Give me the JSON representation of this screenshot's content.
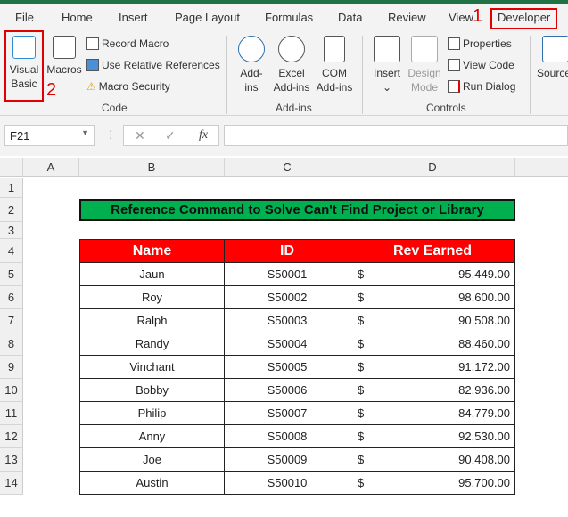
{
  "tabs": [
    "File",
    "Home",
    "Insert",
    "Page Layout",
    "Formulas",
    "Data",
    "Review",
    "View",
    "Developer"
  ],
  "annotations": {
    "one": "1",
    "two": "2"
  },
  "ribbon": {
    "code": {
      "visual_basic": [
        "Visual",
        "Basic"
      ],
      "macros": "Macros",
      "record_macro": "Record Macro",
      "relative": "Use Relative References",
      "security": "Macro Security",
      "label": "Code"
    },
    "addins": {
      "addins": [
        "Add-",
        "ins"
      ],
      "excel": [
        "Excel",
        "Add-ins"
      ],
      "com": [
        "COM",
        "Add-ins"
      ],
      "label": "Add-ins"
    },
    "controls": {
      "insert": "Insert",
      "design": [
        "Design",
        "Mode"
      ],
      "properties": "Properties",
      "view_code": "View Code",
      "run_dialog": "Run Dialog",
      "label": "Controls"
    },
    "source": "Source"
  },
  "formula_bar": {
    "name_box": "F21",
    "fx": "fx",
    "value": ""
  },
  "columns": [
    "A",
    "B",
    "C",
    "D"
  ],
  "rows": [
    "1",
    "2",
    "3",
    "4",
    "5",
    "6",
    "7",
    "8",
    "9",
    "10",
    "11",
    "12",
    "13",
    "14"
  ],
  "sheet": {
    "title": "Reference Command to Solve Can't Find Project or Library",
    "headers": [
      "Name",
      "ID",
      "Rev Earned"
    ],
    "currency": "$",
    "data": [
      [
        "Jaun",
        "S50001",
        "95,449.00"
      ],
      [
        "Roy",
        "S50002",
        "98,600.00"
      ],
      [
        "Ralph",
        "S50003",
        "90,508.00"
      ],
      [
        "Randy",
        "S50004",
        "88,460.00"
      ],
      [
        "Vinchant",
        "S50005",
        "91,172.00"
      ],
      [
        "Bobby",
        "S50006",
        "82,936.00"
      ],
      [
        "Philip",
        "S50007",
        "84,779.00"
      ],
      [
        "Anny",
        "S50008",
        "92,530.00"
      ],
      [
        "Joe",
        "S50009",
        "90,408.00"
      ],
      [
        "Austin",
        "S50010",
        "95,700.00"
      ]
    ]
  }
}
